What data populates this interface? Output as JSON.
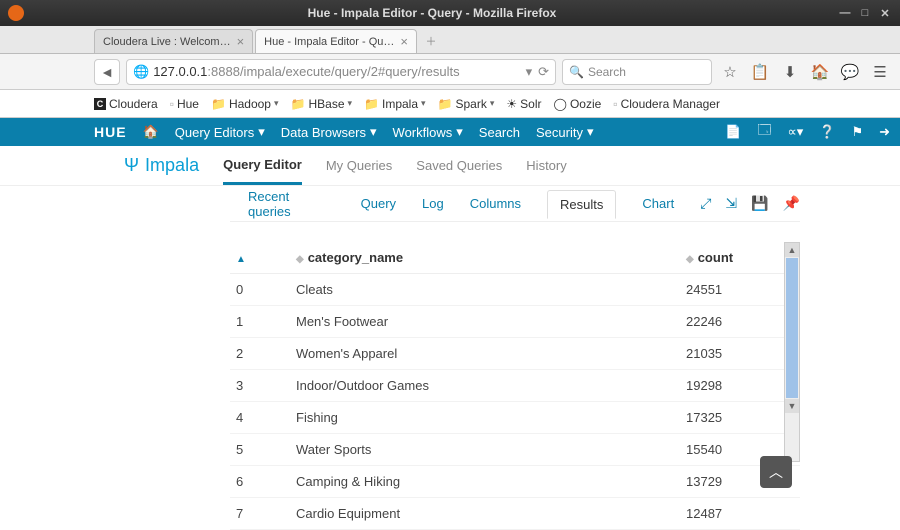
{
  "window": {
    "title": "Hue - Impala Editor - Query - Mozilla Firefox"
  },
  "tabs": [
    {
      "label": "Cloudera Live : Welcom…"
    },
    {
      "label": "Hue - Impala Editor - Qu…"
    }
  ],
  "url": {
    "host": "127.0.0.1",
    "port_path": ":8888/impala/execute/query/2#query/results"
  },
  "search": {
    "placeholder": "Search"
  },
  "bookmarks": {
    "cloudera": "Cloudera",
    "hue": "Hue",
    "hadoop": "Hadoop",
    "hbase": "HBase",
    "impala": "Impala",
    "spark": "Spark",
    "solr": "Solr",
    "oozie": "Oozie",
    "mgr": "Cloudera Manager"
  },
  "huenav": {
    "logo": "HUE",
    "editors": "Query Editors",
    "browsers": "Data Browsers",
    "workflows": "Workflows",
    "search": "Search",
    "security": "Security"
  },
  "subhdr": {
    "impala": "Impala",
    "qe": "Query Editor",
    "mq": "My Queries",
    "sq": "Saved Queries",
    "hist": "History"
  },
  "qtabs": {
    "recent": "Recent queries",
    "query": "Query",
    "log": "Log",
    "columns": "Columns",
    "results": "Results",
    "chart": "Chart"
  },
  "headers": {
    "idx": "",
    "cat": "category_name",
    "cnt": "count"
  },
  "rows": [
    {
      "i": "0",
      "cat": "Cleats",
      "cnt": "24551"
    },
    {
      "i": "1",
      "cat": "Men's Footwear",
      "cnt": "22246"
    },
    {
      "i": "2",
      "cat": "Women's Apparel",
      "cnt": "21035"
    },
    {
      "i": "3",
      "cat": "Indoor/Outdoor Games",
      "cnt": "19298"
    },
    {
      "i": "4",
      "cat": "Fishing",
      "cnt": "17325"
    },
    {
      "i": "5",
      "cat": "Water Sports",
      "cnt": "15540"
    },
    {
      "i": "6",
      "cat": "Camping & Hiking",
      "cnt": "13729"
    },
    {
      "i": "7",
      "cat": "Cardio Equipment",
      "cnt": "12487"
    }
  ],
  "chart_data": {
    "type": "table",
    "columns": [
      "category_name",
      "count"
    ],
    "rows": [
      [
        "Cleats",
        24551
      ],
      [
        "Men's Footwear",
        22246
      ],
      [
        "Women's Apparel",
        21035
      ],
      [
        "Indoor/Outdoor Games",
        19298
      ],
      [
        "Fishing",
        17325
      ],
      [
        "Water Sports",
        15540
      ],
      [
        "Camping & Hiking",
        13729
      ],
      [
        "Cardio Equipment",
        12487
      ]
    ]
  }
}
